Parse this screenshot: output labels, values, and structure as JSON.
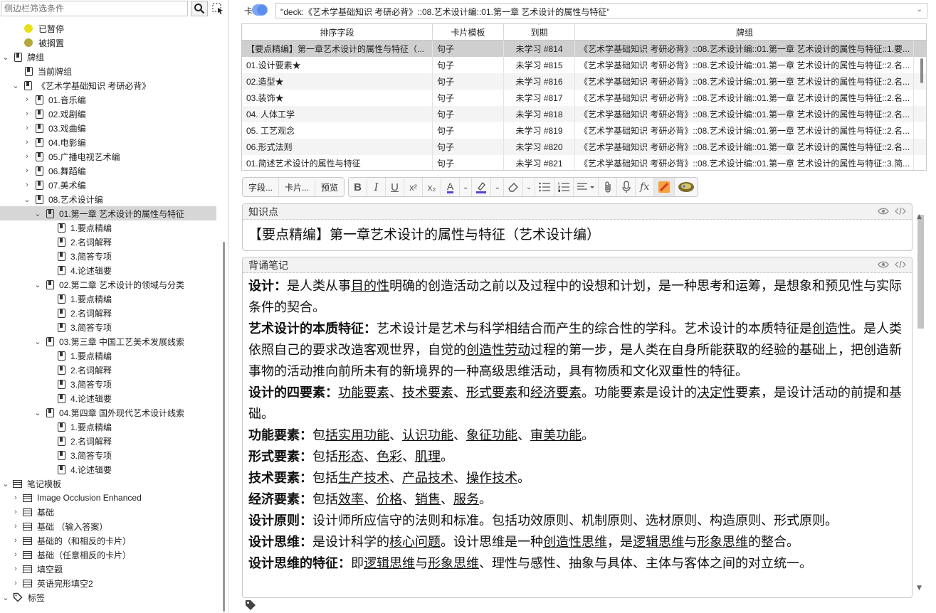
{
  "sidebar": {
    "search_placeholder": "侧边栏筛选条件",
    "items": [
      {
        "label": "已暂停"
      },
      {
        "label": "被搁置"
      },
      {
        "label": "牌组"
      },
      {
        "label": "当前牌组"
      },
      {
        "label": "《艺术学基础知识 考研必背》"
      },
      {
        "label": "01.音乐编"
      },
      {
        "label": "02.戏剧编"
      },
      {
        "label": "03.戏曲编"
      },
      {
        "label": "04.电影编"
      },
      {
        "label": "05.广播电视艺术编"
      },
      {
        "label": "06.舞蹈编"
      },
      {
        "label": "07.美术编"
      },
      {
        "label": "08.艺术设计编"
      },
      {
        "label": "01.第一章 艺术设计的属性与特征"
      },
      {
        "label": "1.要点精编"
      },
      {
        "label": "2.名词解释"
      },
      {
        "label": "3.简答专项"
      },
      {
        "label": "4.论述辑要"
      },
      {
        "label": "02.第二章 艺术设计的领域与分类"
      },
      {
        "label": "1.要点精编"
      },
      {
        "label": "2.名词解释"
      },
      {
        "label": "3.简答专项"
      },
      {
        "label": "03.第三章 中国工艺美术发展线索"
      },
      {
        "label": "1.要点精编"
      },
      {
        "label": "2.名词解释"
      },
      {
        "label": "3.简答专项"
      },
      {
        "label": "4.论述辑要"
      },
      {
        "label": "04.第四章 国外现代艺术设计线索"
      },
      {
        "label": "1.要点精编"
      },
      {
        "label": "2.名词解释"
      },
      {
        "label": "3.简答专项"
      },
      {
        "label": "4.论述辑要"
      },
      {
        "label": "笔记模板"
      },
      {
        "label": "Image Occlusion Enhanced"
      },
      {
        "label": "基础"
      },
      {
        "label": "基础 （输入答案）"
      },
      {
        "label": "基础的（和相反的卡片）"
      },
      {
        "label": "基础（任意相反的卡片）"
      },
      {
        "label": "填空题"
      },
      {
        "label": "英语完形填空2"
      },
      {
        "label": "标签"
      }
    ],
    "colors": {
      "paused": "#e6e019",
      "buried": "#b3a83a"
    }
  },
  "header": {
    "toggle_label": "卡",
    "query": "\"deck:《艺术学基础知识 考研必背》::08.艺术设计编::01.第一章 艺术设计的属性与特征\""
  },
  "table": {
    "columns": [
      "排序字段",
      "卡片模板",
      "到期",
      "牌组"
    ],
    "rows": [
      [
        "【要点精编】第一章艺术设计的属性与特征（...",
        "句子",
        "未学习 #814",
        "《艺术学基础知识 考研必背》::08.艺术设计编::01.第一章 艺术设计的属性与特征::1.要..."
      ],
      [
        "01.设计要素★",
        "句子",
        "未学习 #815",
        "《艺术学基础知识 考研必背》::08.艺术设计编::01.第一章 艺术设计的属性与特征::2.名..."
      ],
      [
        "02.造型★",
        "句子",
        "未学习 #816",
        "《艺术学基础知识 考研必背》::08.艺术设计编::01.第一章 艺术设计的属性与特征::2.名..."
      ],
      [
        "03.装饰★",
        "句子",
        "未学习 #817",
        "《艺术学基础知识 考研必背》::08.艺术设计编::01.第一章 艺术设计的属性与特征::2.名..."
      ],
      [
        "04. 人体工学",
        "句子",
        "未学习 #818",
        "《艺术学基础知识 考研必背》::08.艺术设计编::01.第一章 艺术设计的属性与特征::2.名..."
      ],
      [
        "05. 工艺观念",
        "句子",
        "未学习 #819",
        "《艺术学基础知识 考研必背》::08.艺术设计编::01.第一章 艺术设计的属性与特征::2.名..."
      ],
      [
        "06.形式法则",
        "句子",
        "未学习 #820",
        "《艺术学基础知识 考研必背》::08.艺术设计编::01.第一章 艺术设计的属性与特征::2.名..."
      ],
      [
        "01.简述艺术设计的属性与特征",
        "句子",
        "未学习 #821",
        "《艺术学基础知识 考研必背》::08.艺术设计编::01.第一章 艺术设计的属性与特征::3.简..."
      ]
    ]
  },
  "toolbar": {
    "fields_btn": "字段...",
    "cards_btn": "卡片...",
    "preview_btn": "预览"
  },
  "editor": {
    "field1_name": "知识点",
    "field1_value": "【要点精编】第一章艺术设计的属性与特征（艺术设计编）",
    "field2_name": "背诵笔记",
    "note": {
      "p1_b": "设计：",
      "p1_a": "是人类从事",
      "p1_u1": "目的性",
      "p1_c": "明确的创造活动之前以及过程中的设想和计划，是一种思考和运筹，是想象和预见性与实际条件的契合。",
      "p2_b": "艺术设计的本质特征：",
      "p2_a": "艺术设计是艺术与科学相结合而产生的综合性的学科。艺术设计的本质特征是",
      "p2_u1": "创造性",
      "p2_c": "。是人类依照自己的要求改造客观世界，自觉的",
      "p2_u2": "创造性劳动",
      "p2_d": "过程的第一步，是人类在自身所能获取的经验的基础上，把创造新事物的活动推向前所未有的新境界的一种高级思维活动，具有物质和文化双重性的特征。",
      "p3_b": "设计的四要素：",
      "p3_u1": "功能要素",
      "p3_s1": "、",
      "p3_u2": "技术要素",
      "p3_s2": "、",
      "p3_u3": "形式要素",
      "p3_s3": "和",
      "p3_u4": "经济要素",
      "p3_a": "。功能要素是设计的",
      "p3_u5": "决定性",
      "p3_c": "要素，是设计活动的前提和基础。",
      "p4_b": "功能要素：",
      "p4_a": "包",
      "p4_u1": "括实用功能",
      "p4_s1": "、",
      "p4_u2": "认识功能",
      "p4_s2": "、",
      "p4_u3": "象征功能",
      "p4_s3": "、",
      "p4_u4": "审美功能",
      "p4_e": "。",
      "p5_b": "形式要素：",
      "p5_a": "包括",
      "p5_u1": "形态",
      "p5_s1": "、",
      "p5_u2": "色彩",
      "p5_s2": "、",
      "p5_u3": "肌理",
      "p5_e": "。",
      "p6_b": "技术要素：",
      "p6_a": "包括",
      "p6_u1": "生产技术",
      "p6_s1": "、",
      "p6_u2": "产品技术",
      "p6_s2": "、",
      "p6_u3": "操作技术",
      "p6_e": "。",
      "p7_b": "经济要素：",
      "p7_a": "包括",
      "p7_u1": "效率",
      "p7_s1": "、",
      "p7_u2": "价格",
      "p7_s2": "、",
      "p7_u3": "销售",
      "p7_s3": "、",
      "p7_u4": "服务",
      "p7_e": "。",
      "p8_b": "设计原则：",
      "p8_a": "设计师所应信守的法则和标准。包括功效原则、机制原则、选材原则、构造原则、形式原则。",
      "p9_b": "设计思维：",
      "p9_a": "是设计科学的",
      "p9_u1": "核心问题",
      "p9_c": "。设计思维是一种",
      "p9_u2": "创造性思维",
      "p9_d": "，是",
      "p9_u3": "逻辑思维",
      "p9_s1": "与",
      "p9_u4": "形象思维",
      "p9_e": "的整合。",
      "p10_b": "设计思维的特征：",
      "p10_a": "即",
      "p10_u1": "逻辑思维",
      "p10_s1": "与",
      "p10_u2": "形象思维",
      "p10_c": "、理性与感性、抽象与具体、主体与客体之间的对立统一。"
    }
  }
}
